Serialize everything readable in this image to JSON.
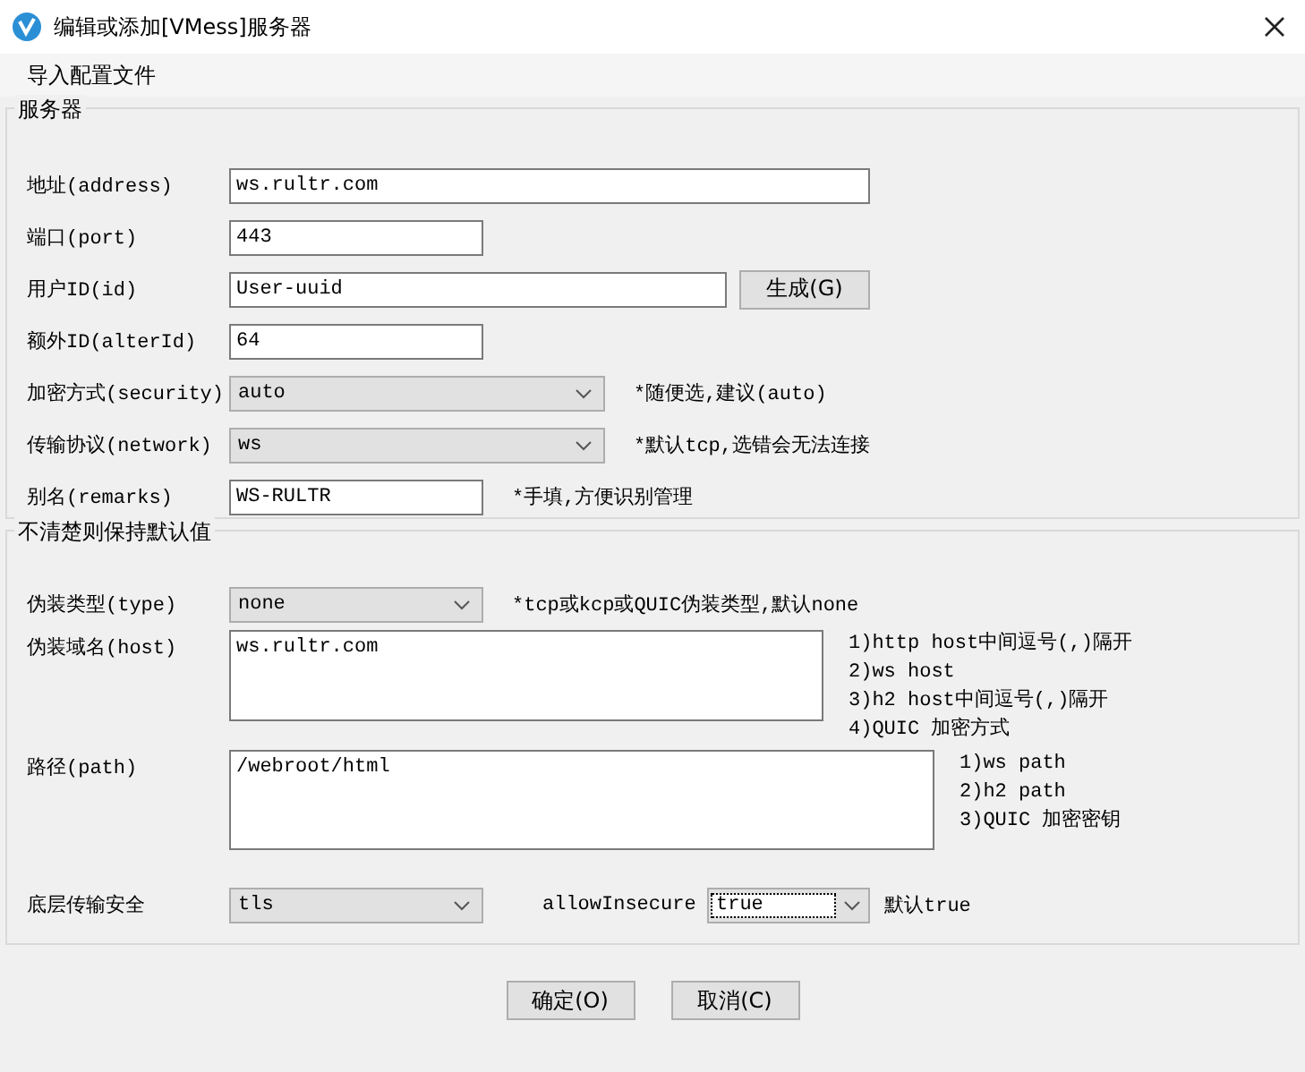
{
  "window": {
    "title": "编辑或添加[VMess]服务器"
  },
  "menu": [
    "导入配置文件"
  ],
  "server": {
    "title": "服务器",
    "rows": [
      {
        "kind": "text",
        "label": "地址(address)",
        "value": "ws.rultr.com"
      },
      {
        "kind": "text",
        "label": "端口(port)",
        "value": "443"
      },
      {
        "kind": "text",
        "label": "用户ID(id)",
        "value": "User-uuid",
        "button": "生成(G)"
      },
      {
        "kind": "text",
        "label": "额外ID(alterId)",
        "value": "64"
      },
      {
        "kind": "select",
        "label": "加密方式(security)",
        "value": "auto",
        "note": "*随便选,建议(auto)"
      },
      {
        "kind": "select",
        "label": "传输协议(network)",
        "value": "ws",
        "note": "*默认tcp,选错会无法连接"
      },
      {
        "kind": "text",
        "label": "别名(remarks)",
        "value": "WS-RULTR",
        "note": "*手填,方便识别管理"
      }
    ]
  },
  "advanced": {
    "title": "不清楚则保持默认值",
    "rows": [
      {
        "kind": "select",
        "label": "伪装类型(type)",
        "value": "none",
        "note": "*tcp或kcp或QUIC伪装类型,默认none"
      },
      {
        "kind": "textarea",
        "label": "伪装域名(host)",
        "value": "ws.rultr.com",
        "hints": [
          "1)http host中间逗号(,)隔开",
          "2)ws host",
          "3)h2 host中间逗号(,)隔开",
          "4)QUIC 加密方式"
        ]
      },
      {
        "kind": "textarea",
        "label": "路径(path)",
        "value": "/webroot/html",
        "hints": [
          "1)ws path",
          "2)h2 path",
          "3)QUIC 加密密钥"
        ]
      },
      {
        "kind": "select",
        "label": "底层传输安全",
        "value": "tls",
        "extra": {
          "label": "allowInsecure",
          "value": "true",
          "focused": true,
          "note": "默认true"
        }
      }
    ]
  },
  "buttons": [
    "确定(O)",
    "取消(C)"
  ]
}
